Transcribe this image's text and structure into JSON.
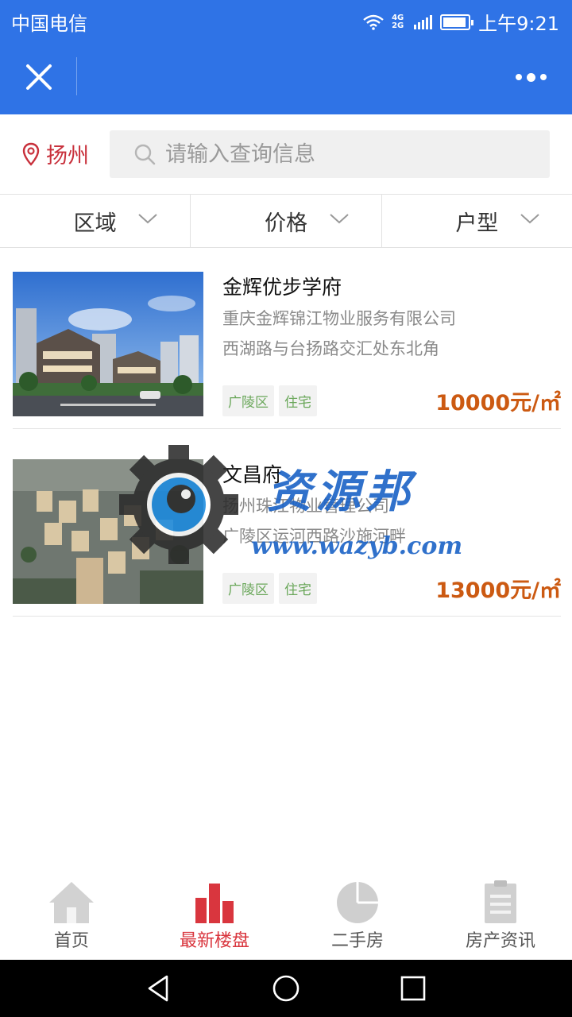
{
  "status_bar": {
    "carrier": "中国电信",
    "network": [
      "4G",
      "2G"
    ],
    "time": "上午9:21"
  },
  "title_bar": {
    "close_icon": "close-icon",
    "more_icon": "more-dots-icon"
  },
  "search": {
    "city": "扬州",
    "placeholder": "请输入查询信息",
    "value": ""
  },
  "filters": [
    {
      "label": "区域"
    },
    {
      "label": "价格"
    },
    {
      "label": "户型"
    }
  ],
  "listings": [
    {
      "name": "金辉优步学府",
      "company": "重庆金辉锦江物业服务有限公司",
      "address": "西湖路与台扬路交汇处东北角",
      "tags": [
        "广陵区",
        "住宅"
      ],
      "price": "10000元/㎡"
    },
    {
      "name": "文昌府",
      "company": "扬州珠江物业管理公司",
      "address": "广陵区运河西路沙施河畔",
      "tags": [
        "广陵区",
        "住宅"
      ],
      "price": "13000元/㎡"
    }
  ],
  "watermark": {
    "text": "资源邦",
    "url": "www.wazyb.com"
  },
  "tabs": [
    {
      "label": "首页",
      "icon": "home-icon",
      "active": false
    },
    {
      "label": "最新楼盘",
      "icon": "bar-chart-icon",
      "active": true
    },
    {
      "label": "二手房",
      "icon": "pie-chart-icon",
      "active": false
    },
    {
      "label": "房产资讯",
      "icon": "clipboard-icon",
      "active": false
    }
  ],
  "colors": {
    "brand_blue": "#2f73e6",
    "accent_red": "#d9363e",
    "price_orange": "#cc5a12",
    "tag_green": "#6aa75a"
  }
}
